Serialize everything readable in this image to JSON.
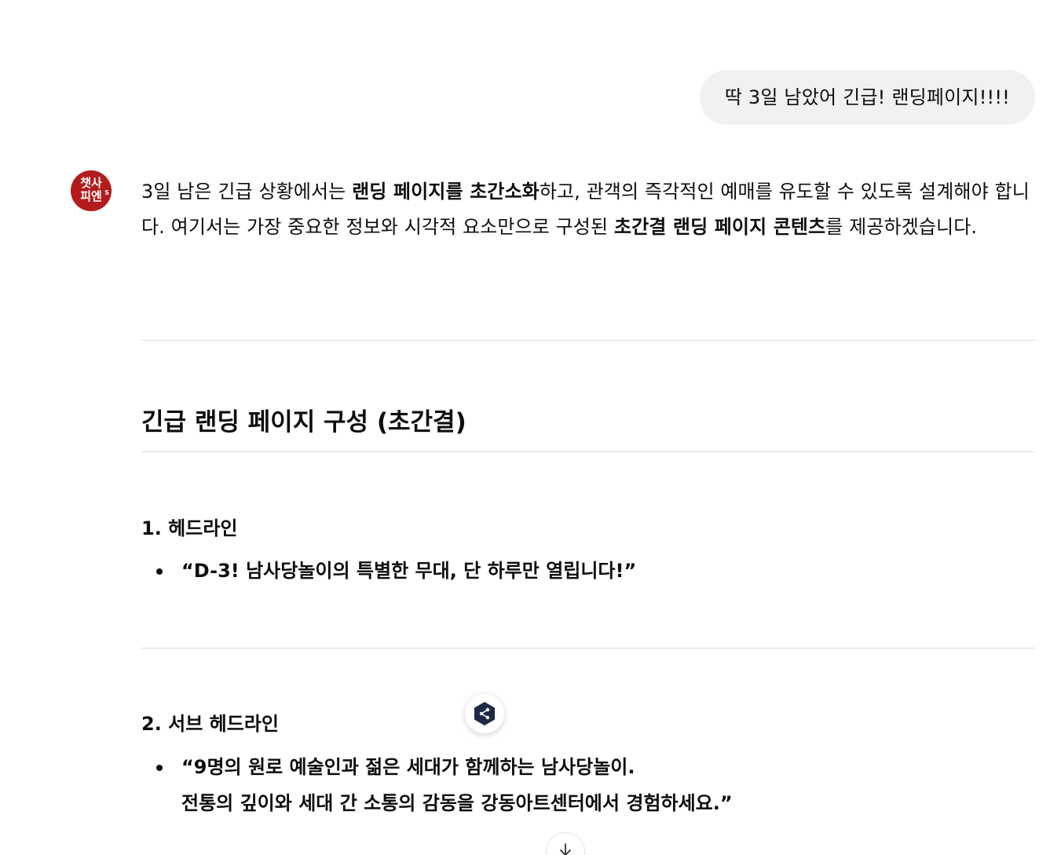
{
  "user_message": "딱 3일 남았어 긴급! 랜딩페이지!!!!",
  "assistant": {
    "avatar": {
      "line1": "챗사",
      "line2": "피엔",
      "superscript": "S",
      "color": "#b31c1c"
    },
    "intro": {
      "t1": "3일 남은 긴급 상황에서는 ",
      "b1": "랜딩 페이지를 초간소화",
      "t2": "하고, 관객의 즉각적인 예매를 유도할 수 있도록 설계해야 합니다. 여기서는 가장 중요한 정보와 시각적 요소만으로 구성된 ",
      "b2": "초간결 랜딩 페이지 콘텐츠",
      "t3": "를 제공하겠습니다."
    },
    "section_title": "긴급 랜딩 페이지 구성 (초간결)",
    "sections": [
      {
        "heading": "1. 헤드라인",
        "bullets": [
          [
            "“D-3! 남사당놀이의 특별한 무대, 단 하루만 열립니다!”"
          ]
        ]
      },
      {
        "heading": "2. 서브 헤드라인",
        "bullets": [
          [
            "“9명의 원로 예술인과 젊은 세대가 함께하는 남사당놀이.",
            "전통의 깊이와 세대 간 소통의 감동을 강동아트센터에서 경험하세요.”"
          ]
        ]
      }
    ]
  },
  "floating_button_icon": "share-hexagon-icon",
  "scroll_button_icon": "arrow-down-icon"
}
